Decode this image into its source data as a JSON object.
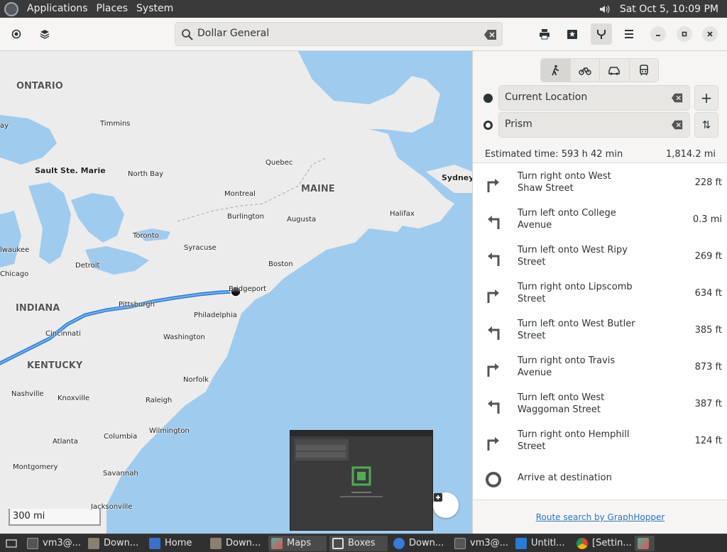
{
  "top_panel": {
    "menus": [
      "Applications",
      "Places",
      "System"
    ],
    "clock": "Sat Oct  5, 10:09 PM"
  },
  "header": {
    "search_value": "Dollar General",
    "icons": [
      "location-icon",
      "layers-icon",
      "print-icon",
      "favorites-icon",
      "route-icon",
      "menu-icon",
      "minimize-icon",
      "maximize-icon",
      "close-icon"
    ]
  },
  "map": {
    "labels": {
      "ontario": "ONTARIO",
      "maine": "MAINE",
      "indiana": "INDIANA",
      "kentucky": "KENTUCKY",
      "timmins": "Timmins",
      "sault": "Sault Ste. Marie",
      "northbay": "North Bay",
      "quebec": "Quebec",
      "sydney": "Sydney",
      "montreal": "Montreal",
      "burlington": "Burlington",
      "augusta": "Augusta",
      "halifax": "Halifax",
      "toronto": "Toronto",
      "syracuse": "Syracuse",
      "milwaukee": "lwaukee",
      "chicago": "Chicago",
      "detroit": "Detroit",
      "boston": "Boston",
      "bridgeport": "Bridgeport",
      "pittsburgh": "Pittsburgh",
      "philadelphia": "Philadelphia",
      "cincinnati": "Cincinnati",
      "washington": "Washington",
      "norfolk": "Norfolk",
      "nashville": "Nashville",
      "knoxville": "Knoxville",
      "raleigh": "Raleigh",
      "wilmington": "Wilmington",
      "atlanta": "Atlanta",
      "columbia": "Columbia",
      "montgomery": "Montgomery",
      "savannah": "Savannah",
      "jacksonville": "Jacksonville",
      "ay": "ay"
    },
    "scale": "300 mi"
  },
  "sidebar": {
    "modes": [
      "walk-icon",
      "bike-icon",
      "car-icon",
      "transit-icon"
    ],
    "waypoints": [
      {
        "value": "Current Location",
        "action": "+"
      },
      {
        "value": "Prism",
        "action": "⇅"
      }
    ],
    "estimated_time": "Estimated time: 593 h 42 min",
    "total_distance": "1,814.2 mi",
    "instructions": [
      {
        "text": "Turn right onto West Shaw Street",
        "dist": "228 ft",
        "dir": "right"
      },
      {
        "text": "Turn left onto College Avenue",
        "dist": "0.3 mi",
        "dir": "left"
      },
      {
        "text": "Turn left onto West Ripy Street",
        "dist": "269 ft",
        "dir": "left"
      },
      {
        "text": "Turn right onto Lipscomb Street",
        "dist": "634 ft",
        "dir": "right"
      },
      {
        "text": "Turn left onto West Butler Street",
        "dist": "385 ft",
        "dir": "left"
      },
      {
        "text": "Turn right onto Travis Avenue",
        "dist": "873 ft",
        "dir": "right"
      },
      {
        "text": "Turn left onto West Waggoman Street",
        "dist": "387 ft",
        "dir": "left"
      },
      {
        "text": "Turn right onto Hemphill Street",
        "dist": "124 ft",
        "dir": "right"
      },
      {
        "text": "Arrive at destination",
        "dist": "",
        "dir": "arrive"
      }
    ],
    "credit": "Route search by GraphHopper"
  },
  "taskbar": {
    "items": [
      {
        "label": "vm3@...",
        "icon": "terminal-icon"
      },
      {
        "label": "Down...",
        "icon": "folder-icon"
      },
      {
        "label": "Home",
        "icon": "document-icon"
      },
      {
        "label": "Down...",
        "icon": "folder-icon"
      },
      {
        "label": "Maps",
        "icon": "maps-icon"
      },
      {
        "label": "Boxes",
        "icon": "boxes-icon"
      },
      {
        "label": "Down...",
        "icon": "browser-icon"
      },
      {
        "label": "vm3@...",
        "icon": "terminal-icon"
      },
      {
        "label": "Untitl...",
        "icon": "writer-icon"
      },
      {
        "label": "[Settin...",
        "icon": "chrome-icon"
      }
    ]
  }
}
